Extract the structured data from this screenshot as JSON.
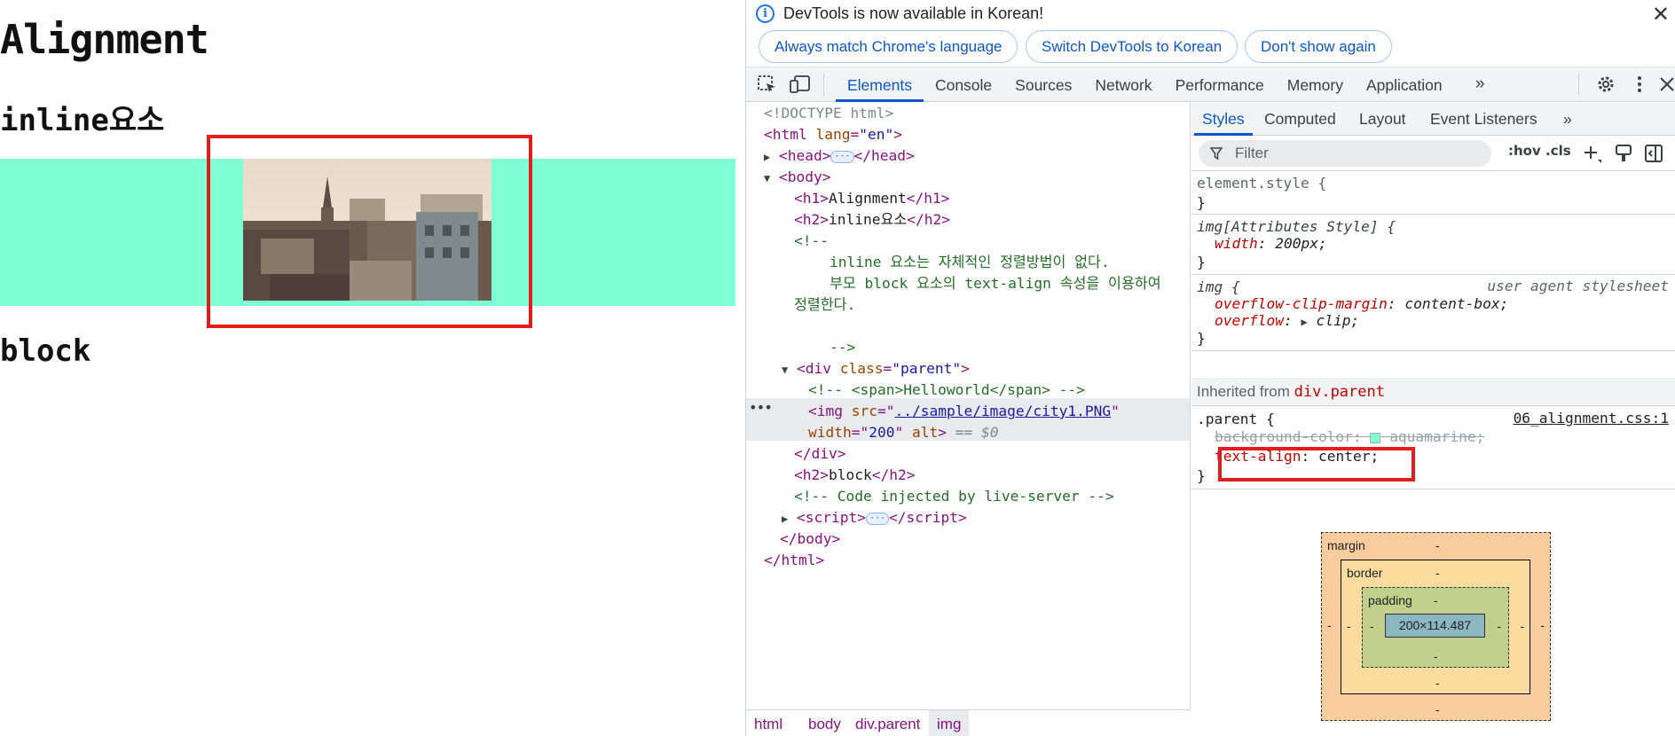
{
  "page": {
    "h1": "Alignment",
    "h2_inline": "inline요소",
    "h2_block": "block"
  },
  "devtools": {
    "info_message": "DevTools is now available in Korean!",
    "buttons": [
      "Always match Chrome's language",
      "Switch DevTools to Korean",
      "Don't show again"
    ],
    "close": "✕",
    "tabs": [
      "Elements",
      "Console",
      "Sources",
      "Network",
      "Performance",
      "Memory",
      "Application"
    ],
    "active_tab": "Elements",
    "more_tabs": "»"
  },
  "elements": {
    "lines": {
      "doctype": "<!DOCTYPE html>",
      "c1": "inline 요소는 자체적인 정렬방법이 없다.",
      "c2": "부모 block 요소의 text-align 속성을 이용하여",
      "c3": "정렬한다.",
      "c4": "-->",
      "c_open": "<!--",
      "span_comment": "<!-- <span>Helloworld</span> -->",
      "live_comment": "<!-- Code injected by live-server -->",
      "h1_text": "Alignment",
      "h2_text": "inline요소",
      "h2b_text": "block",
      "img_src": "../sample/image/city1.PNG",
      "img_width": "200",
      "selected_marker": "== $0",
      "lang_val": "\"en\"",
      "class_val": "\"parent\""
    },
    "breadcrumbs": [
      "html",
      "body",
      "div.parent",
      "img"
    ],
    "active_breadcrumb": "img"
  },
  "styles": {
    "tabs": [
      "Styles",
      "Computed",
      "Layout",
      "Event Listeners"
    ],
    "active_tab": "Styles",
    "filter_placeholder": "Filter",
    "hov": ":hov",
    "cls": ".cls",
    "rules": {
      "element_style": "element.style {",
      "attr_selector": "img[Attributes Style] {",
      "attr_prop": "width",
      "attr_val": "200px;",
      "img_selector": "img {",
      "ua_label": "user agent stylesheet",
      "ua_p1": "overflow-clip-margin",
      "ua_v1": "content-box;",
      "ua_p2": "overflow",
      "ua_v2": "clip;",
      "inherited_label": "Inherited from",
      "inherited_from": "div.parent",
      "parent_selector": ".parent {",
      "parent_src": "06_alignment.css:1",
      "bg_prop": "background-color",
      "bg_val": "aquamarine;",
      "ta_prop": "text-align",
      "ta_val": "center;",
      "close_brace": "}"
    },
    "box_model": {
      "margin": "margin",
      "border": "border",
      "padding": "padding",
      "content": "200×114.487",
      "dash": "-"
    }
  },
  "colors": {
    "parent_bg": "#7fffd4",
    "highlight": "#e31c1c",
    "accent": "#0b57d0"
  }
}
